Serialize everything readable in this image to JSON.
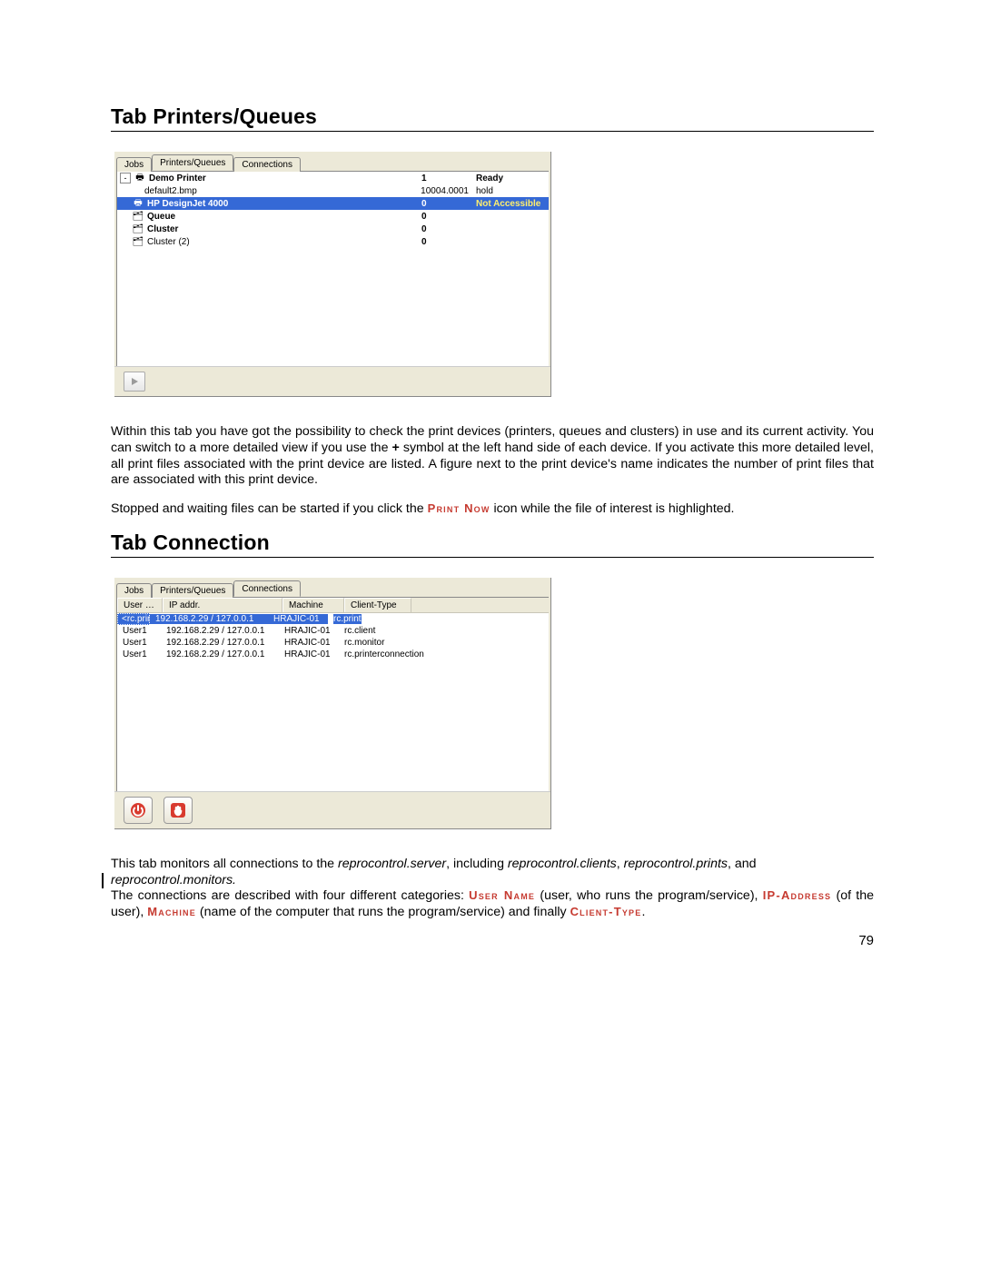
{
  "sections": {
    "printers_heading": "Tab Printers/Queues",
    "connection_heading": "Tab Connection"
  },
  "printers_panel": {
    "tabs": {
      "jobs": "Jobs",
      "printers": "Printers/Queues",
      "connections": "Connections"
    },
    "rows": [
      {
        "expander": "-",
        "icon": "🖶",
        "name": "Demo Printer",
        "value": "1",
        "status": "Ready",
        "bold": true
      },
      {
        "child": true,
        "name": "default2.bmp",
        "value": "10004.0001",
        "status": "hold"
      },
      {
        "selected": true,
        "icon": "🖶",
        "name": "HP DesignJet 4000",
        "value": "0",
        "status": "Not Accessible",
        "bold": true
      },
      {
        "icon": "🗂",
        "name": "Queue",
        "value": "0",
        "status": "",
        "bold": true
      },
      {
        "icon": "🗂",
        "name": "Cluster",
        "value": "0",
        "status": "",
        "bold": true
      },
      {
        "icon": "🗂",
        "name": "Cluster (2)",
        "value": "0",
        "status": "",
        "bold": false
      }
    ]
  },
  "printers_body": {
    "p1_a": "Within this tab you have got the possibility to check the print devices (printers, queues and clusters) in use and its current activity. You can switch to a more detailed view if you use the ",
    "plus": "+",
    "p1_b": " symbol at the left hand side of each device. If you activate this more detailed level, all print files associated with the print device are listed. A figure next to the print device's name indicates the number of print files that are associated with this print device.",
    "p2_a": "Stopped and waiting files can be started if you click the ",
    "p2_sc": "Print Now",
    "p2_b": "  icon while the file of interest is highlighted."
  },
  "conn_panel": {
    "tabs": {
      "jobs": "Jobs",
      "printers": "Printers/Queues",
      "connections": "Connections"
    },
    "headers": {
      "user": "User …",
      "ip": "IP addr.",
      "machine": "Machine",
      "client": "Client-Type"
    },
    "rows": [
      {
        "selected": true,
        "user": "<rc.print>",
        "ip": "192.168.2.29 / 127.0.0.1",
        "machine": "HRAJIC-01",
        "client": "rc.print"
      },
      {
        "user": "User1",
        "ip": "192.168.2.29 / 127.0.0.1",
        "machine": "HRAJIC-01",
        "client": "rc.client"
      },
      {
        "user": "User1",
        "ip": "192.168.2.29 / 127.0.0.1",
        "machine": "HRAJIC-01",
        "client": "rc.monitor"
      },
      {
        "user": "User1",
        "ip": "192.168.2.29 / 127.0.0.1",
        "machine": "HRAJIC-01",
        "client": "rc.printerconnection"
      }
    ]
  },
  "conn_body": {
    "p1_a": "This tab monitors all connections to the ",
    "p1_i1": "reprocontrol.server",
    "p1_b": ", including ",
    "p1_i2": "reprocontrol.clients",
    "p1_c": ", ",
    "p1_i3": "reprocontrol.prints",
    "p1_d": ", and ",
    "change_line": "reprocontrol.monitors.",
    "p2_a": "The connections are described with four different categories: ",
    "sc_user": "User Name",
    "p2_b": " (user, who runs the program/service), ",
    "sc_ip": "IP-Address",
    "p2_c": " (of the user), ",
    "sc_machine": "Machine",
    "p2_d": " (name of the computer that runs the program/service) and finally ",
    "sc_client": "Client-Type",
    "p2_e": "."
  },
  "page_number": "79"
}
